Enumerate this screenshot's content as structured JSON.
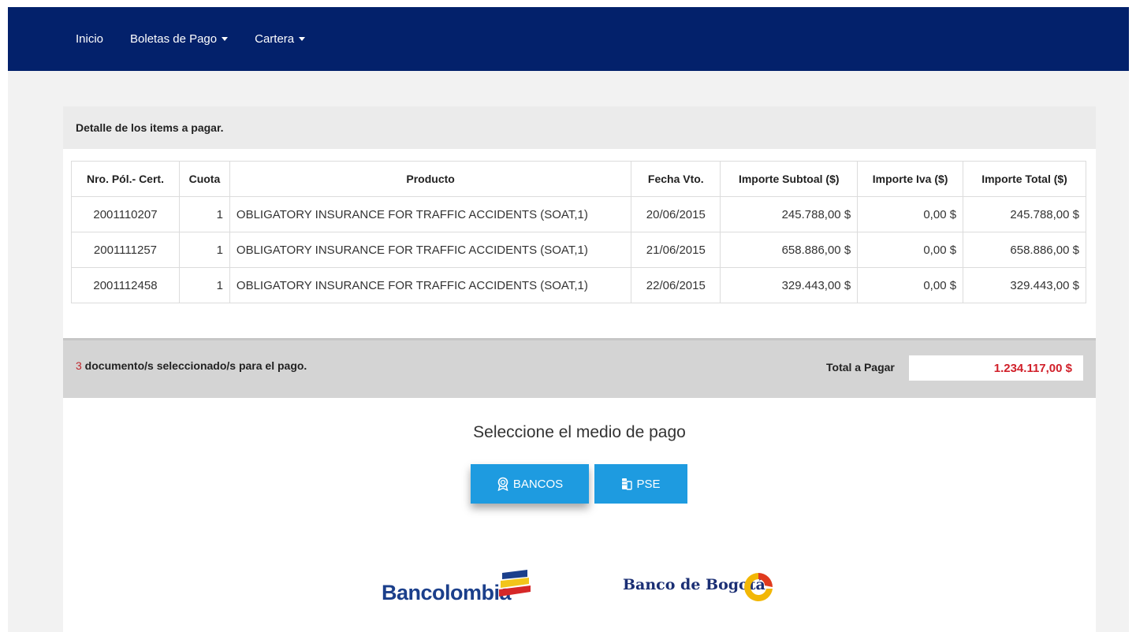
{
  "nav": {
    "items": [
      {
        "label": "Inicio",
        "dropdown": false
      },
      {
        "label": "Boletas de Pago",
        "dropdown": true
      },
      {
        "label": "Cartera",
        "dropdown": true
      }
    ]
  },
  "section": {
    "title": "Detalle de los items a pagar."
  },
  "table": {
    "headers": [
      "Nro. Pól.- Cert.",
      "Cuota",
      "Producto",
      "Fecha Vto.",
      "Importe Subtoal ($)",
      "Importe Iva ($)",
      "Importe Total ($)"
    ],
    "rows": [
      [
        "2001110207",
        "1",
        "OBLIGATORY INSURANCE FOR TRAFFIC ACCIDENTS (SOAT,1)",
        "20/06/2015",
        "245.788,00 $",
        "0,00 $",
        "245.788,00 $"
      ],
      [
        "2001111257",
        "1",
        "OBLIGATORY INSURANCE FOR TRAFFIC ACCIDENTS (SOAT,1)",
        "21/06/2015",
        "658.886,00 $",
        "0,00 $",
        "658.886,00 $"
      ],
      [
        "2001112458",
        "1",
        "OBLIGATORY INSURANCE FOR TRAFFIC ACCIDENTS (SOAT,1)",
        "22/06/2015",
        "329.443,00 $",
        "0,00 $",
        "329.443,00 $"
      ]
    ]
  },
  "summary": {
    "count": "3",
    "count_text": " documento/s seleccionado/s para el pago.",
    "total_label": "Total a Pagar",
    "total_value": "1.234.117,00 $"
  },
  "payment": {
    "title": "Seleccione el medio de pago",
    "bancos_label": "BANCOS",
    "pse_label": "PSE",
    "bank_logos": [
      "Bancolombia",
      "Banco de Bogotá"
    ]
  },
  "colors": {
    "navbar": "#03216b",
    "button": "#1e9be0",
    "total": "#d1202a"
  }
}
